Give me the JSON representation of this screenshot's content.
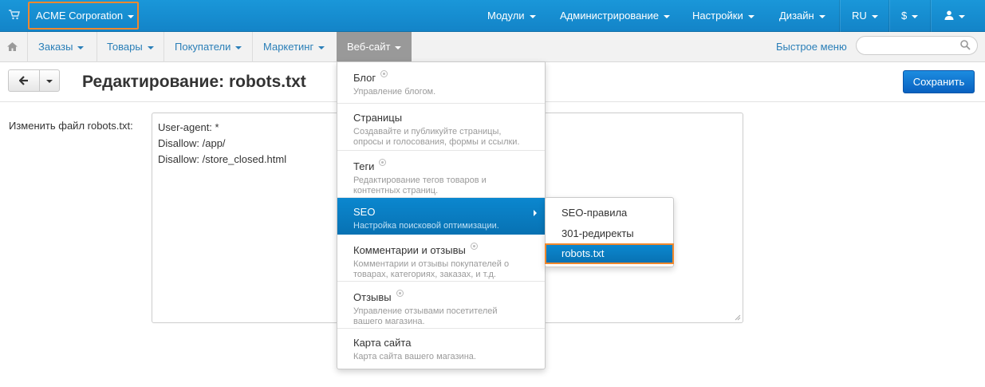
{
  "topbar": {
    "company": "ACME Corporation",
    "nav": [
      "Модули",
      "Администрирование",
      "Настройки",
      "Дизайн"
    ],
    "language": "RU",
    "currency": "$"
  },
  "subnav": {
    "items": [
      "Заказы",
      "Товары",
      "Покупатели",
      "Маркетинг"
    ],
    "active": "Веб-сайт",
    "quick_menu": "Быстрое меню",
    "search_placeholder": ""
  },
  "toolbar": {
    "title": "Редактирование: robots.txt",
    "save_label": "Сохранить"
  },
  "form": {
    "label": "Изменить файл robots.txt:",
    "lines": [
      "User-agent: *",
      "Disallow: /app/",
      "Disallow: /store_closed.html"
    ]
  },
  "menu": {
    "items": [
      {
        "title": "Блог",
        "desc": "Управление блогом."
      },
      {
        "title": "Страницы",
        "desc": "Создавайте и публикуйте страницы, опросы и голосования, формы и ссылки."
      },
      {
        "title": "Теги",
        "desc": "Редактирование тегов товаров и контентных страниц."
      },
      {
        "title": "SEO",
        "desc": "Настройка поисковой оптимизации."
      },
      {
        "title": "Комментарии и отзывы",
        "desc": "Комментарии и отзывы покупателей о товарах, категориях, заказах, и т.д."
      },
      {
        "title": "Отзывы",
        "desc": "Управление отзывами посетителей вашего магазина."
      },
      {
        "title": "Карта сайта",
        "desc": "Карта сайта вашего магазина."
      }
    ]
  },
  "submenu": {
    "items": [
      "SEO-правила",
      "301-редиректы",
      "robots.txt"
    ]
  },
  "colors": {
    "topbar": "#1384c8",
    "highlight": "#f0882d",
    "selected": "#0b7dc1",
    "save_button": "#0961c0"
  }
}
